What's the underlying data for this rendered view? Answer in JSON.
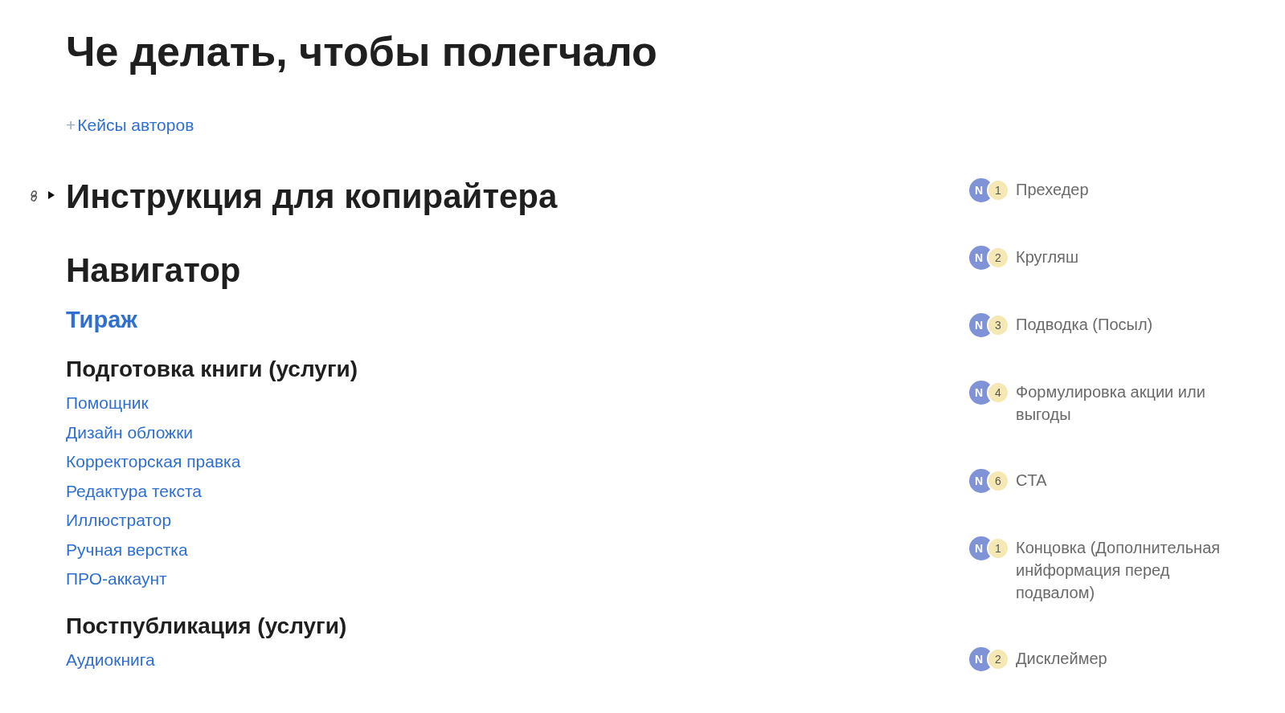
{
  "page_title": "Че делать, чтобы полегчало",
  "add_link": {
    "icon": "+",
    "label": "Кейсы авторов"
  },
  "toggle_heading": {
    "text": "Инструкция для копирайтера",
    "expanded": false
  },
  "navigator": {
    "title": "Навигатор",
    "highlight": "Тираж",
    "groups": [
      {
        "title": "Подготовка книги (услуги)",
        "links": [
          "Помощник",
          "Дизайн обложки",
          "Корректорская правка",
          "Редактура текста",
          "Иллюстратор",
          "Ручная верстка",
          "ПРО-аккаунт"
        ]
      },
      {
        "title": "Постпубликация (услуги)",
        "links": [
          "Аудиокнига"
        ]
      }
    ]
  },
  "comments": [
    {
      "avatar": "N",
      "count": "1",
      "text": "Прехедер"
    },
    {
      "avatar": "N",
      "count": "2",
      "text": "Кругляш"
    },
    {
      "avatar": "N",
      "count": "3",
      "text": "Подводка (Посыл)"
    },
    {
      "avatar": "N",
      "count": "4",
      "text": "Формулировка акции или выгоды"
    },
    {
      "avatar": "N",
      "count": "6",
      "text": "CTA"
    },
    {
      "avatar": "N",
      "count": "1",
      "text": "Концовка (Дополнительная инйформация перед подвалом)"
    },
    {
      "avatar": "N",
      "count": "2",
      "text": "Дисклеймер"
    }
  ]
}
